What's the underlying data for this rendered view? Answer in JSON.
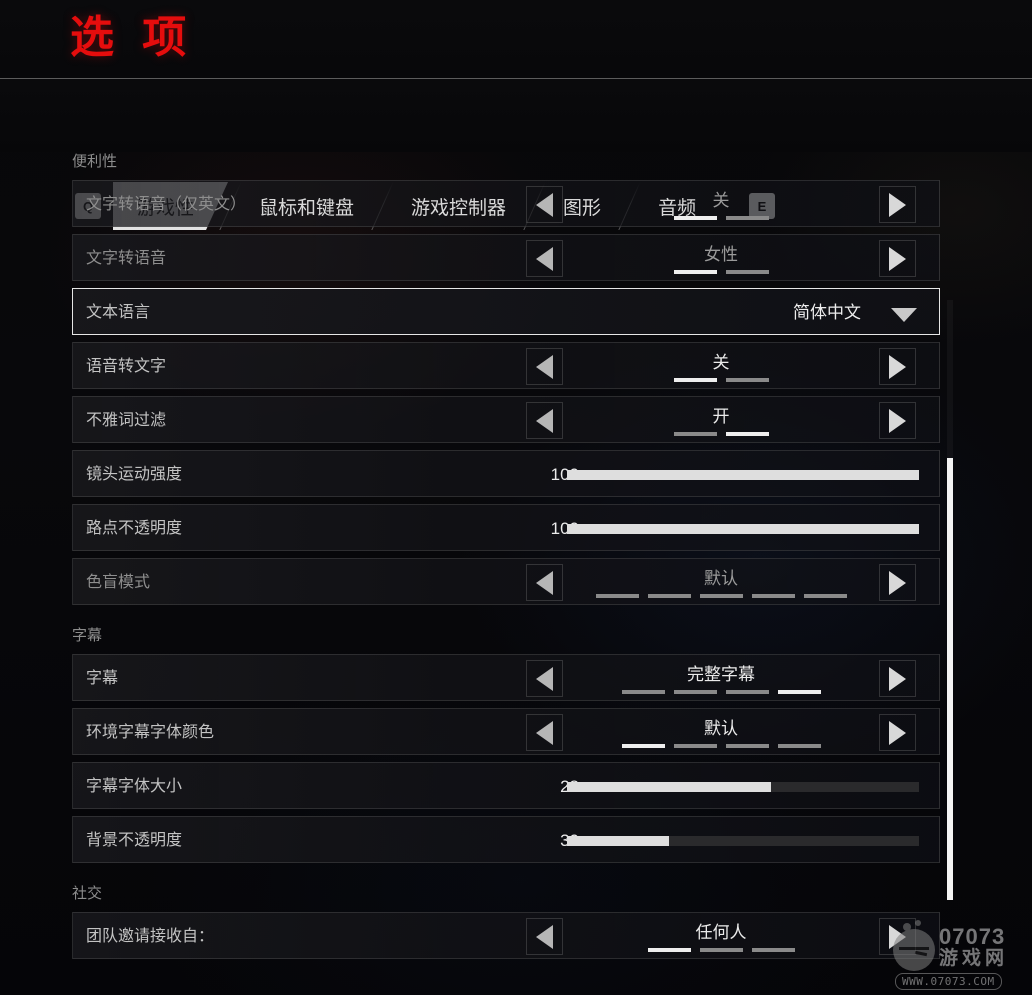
{
  "header": {
    "title": "选 项"
  },
  "tabbar": {
    "key_prev": "Q",
    "key_next": "E",
    "tabs": [
      {
        "label": "游戏性",
        "active": true
      },
      {
        "label": "鼠标和键盘",
        "active": false
      },
      {
        "label": "游戏控制器",
        "active": false
      },
      {
        "label": "图形",
        "active": false
      },
      {
        "label": "音频",
        "active": false
      }
    ]
  },
  "sections": [
    {
      "title": "便利性",
      "rows": [
        {
          "label": "文字转语音（仅英文）",
          "type": "stepper",
          "value": "关",
          "pip_count": 2,
          "pip_selected": 0,
          "dim": true,
          "focused": false
        },
        {
          "label": "文字转语音",
          "type": "stepper",
          "value": "女性",
          "pip_count": 2,
          "pip_selected": 0,
          "dim": true,
          "focused": false
        },
        {
          "label": "文本语言",
          "type": "dropdown",
          "value": "简体中文",
          "caret": "chevron-down-icon",
          "dim": false,
          "focused": true
        },
        {
          "label": "语音转文字",
          "type": "stepper",
          "value": "关",
          "pip_count": 2,
          "pip_selected": 0,
          "dim": false,
          "focused": false
        },
        {
          "label": "不雅词过滤",
          "type": "stepper",
          "value": "开",
          "pip_count": 2,
          "pip_selected": 1,
          "dim": false,
          "focused": false
        },
        {
          "label": "镜头运动强度",
          "type": "slider",
          "value": "100",
          "fill_percent": 100,
          "dim": false,
          "focused": false
        },
        {
          "label": "路点不透明度",
          "type": "slider",
          "value": "100",
          "fill_percent": 100,
          "dim": false,
          "focused": false
        },
        {
          "label": "色盲模式",
          "type": "stepper",
          "value": "默认",
          "pip_count": 5,
          "pip_selected": -1,
          "dim": true,
          "focused": false
        }
      ]
    },
    {
      "title": "字幕",
      "rows": [
        {
          "label": "字幕",
          "type": "stepper",
          "value": "完整字幕",
          "pip_count": 4,
          "pip_selected": 3,
          "dim": false,
          "focused": false
        },
        {
          "label": "环境字幕字体颜色",
          "type": "stepper",
          "value": "默认",
          "pip_count": 4,
          "pip_selected": 0,
          "dim": false,
          "focused": false
        },
        {
          "label": "字幕字体大小",
          "type": "slider",
          "value": "28",
          "fill_percent": 58,
          "dim": false,
          "focused": false
        },
        {
          "label": "背景不透明度",
          "type": "slider",
          "value": "30",
          "fill_percent": 29,
          "dim": false,
          "focused": false
        }
      ]
    },
    {
      "title": "社交",
      "rows": [
        {
          "label": "团队邀请接收自：",
          "type": "stepper",
          "value": "任何人",
          "pip_count": 3,
          "pip_selected": 0,
          "dim": false,
          "focused": false
        }
      ]
    }
  ],
  "scrollbar": {
    "name": "vertical-scrollbar"
  },
  "watermark": {
    "brand": "07073",
    "brand_cn": "游戏网",
    "url": "WWW.07073.COM"
  },
  "colors": {
    "title_red": "#e50d0d",
    "active_tab_bg": "#e2e2e2",
    "slider_fill": "#dedede",
    "pip_on": "#eeeeee",
    "pip_off": "#8a8a8a"
  }
}
